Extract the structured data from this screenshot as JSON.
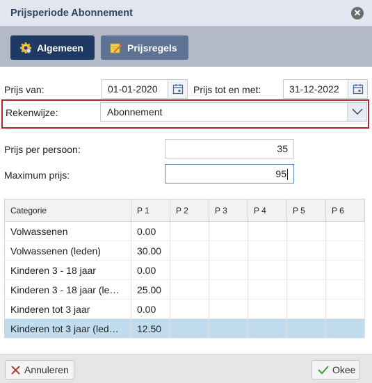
{
  "dialog": {
    "title": "Prijsperiode Abonnement"
  },
  "tabs": [
    {
      "label": "Algemeen",
      "icon": "gear-icon",
      "active": true
    },
    {
      "label": "Prijsregels",
      "icon": "pencil-note-icon",
      "active": false
    }
  ],
  "form": {
    "price_from_label": "Prijs van:",
    "price_from_value": "01-01-2020",
    "price_until_label": "Prijs tot en met:",
    "price_until_value": "31-12-2022",
    "method_label": "Rekenwijze:",
    "method_value": "Abonnement",
    "price_per_person_label": "Prijs per persoon:",
    "price_per_person_value": "35",
    "max_price_label": "Maximum prijs:",
    "max_price_value": "95"
  },
  "table": {
    "headers": [
      "Categorie",
      "P 1",
      "P 2",
      "P 3",
      "P 4",
      "P 5",
      "P 6"
    ],
    "rows": [
      [
        "Volwassenen",
        "0.00",
        "",
        "",
        "",
        "",
        ""
      ],
      [
        "Volwassenen (leden)",
        "30.00",
        "",
        "",
        "",
        "",
        ""
      ],
      [
        "Kinderen 3 - 18 jaar",
        "0.00",
        "",
        "",
        "",
        "",
        ""
      ],
      [
        "Kinderen 3 - 18 jaar (le…",
        "25.00",
        "",
        "",
        "",
        "",
        ""
      ],
      [
        "Kinderen tot 3 jaar",
        "0.00",
        "",
        "",
        "",
        "",
        ""
      ],
      [
        "Kinderen tot 3 jaar (led…",
        "12.50",
        "",
        "",
        "",
        "",
        ""
      ]
    ],
    "selected_row": 5
  },
  "footer": {
    "cancel_label": "Annuleren",
    "ok_label": "Okee"
  },
  "colors": {
    "accent": "#1e3a63",
    "highlight_border": "#b9242f",
    "selected_row": "#c2dcef"
  }
}
